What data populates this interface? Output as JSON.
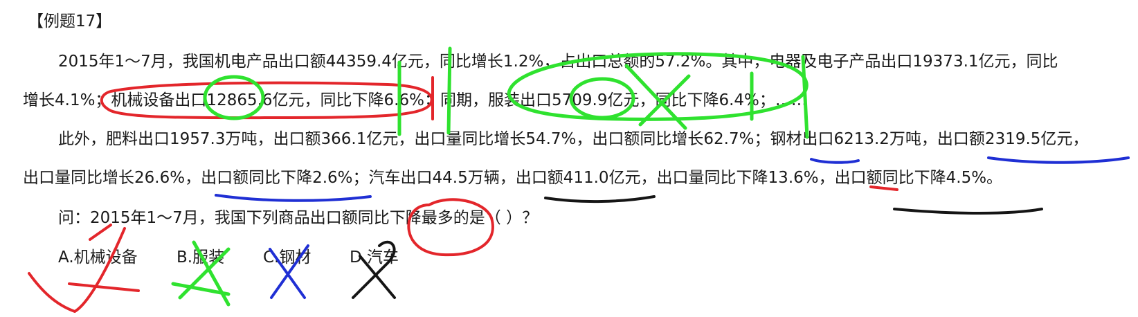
{
  "title": "【例题17】",
  "paragraph": {
    "line1": "2015年1～7月，我国机电产品出口额44359.4亿元，同比增长1.2%，占出口总额的57.2%。其中，电器及电子产品出口19373.1亿元，同比",
    "line2": "增长4.1%；机械设备出口12865.6亿元，同比下降6.6%；同期，服装出口5709.9亿元，同比下降6.4%；……",
    "line3": "此外，肥料出口1957.3万吨，出口额366.1亿元，出口量同比增长54.7%，出口额同比增长62.7%；钢材出口6213.2万吨，出口额2319.5亿元，",
    "line4": "出口量同比增长26.6%，出口额同比下降2.6%；汽车出口44.5万辆，出口额411.0亿元，出口量同比下降13.6%，出口额同比下降4.5%。"
  },
  "question": "问：2015年1～7月，我国下列商品出口额同比下降最多的是（  ）？",
  "options": [
    {
      "label": "A.机械设备"
    },
    {
      "label": "B.服装"
    },
    {
      "label": "C.钢材"
    },
    {
      "label": "D.汽车"
    }
  ],
  "annotation_colors": {
    "red": "#e3262b",
    "green": "#2fe22f",
    "blue": "#1f2fd4",
    "black": "#151515"
  }
}
